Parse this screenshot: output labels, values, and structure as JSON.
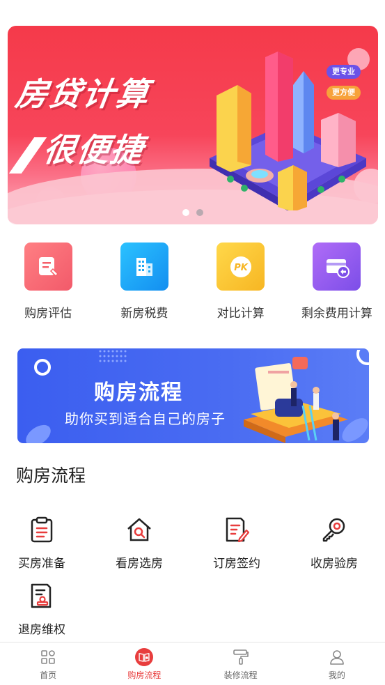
{
  "banner": {
    "title_line1": "房贷计算",
    "title_line2": "很便捷",
    "tag1": "更专业",
    "tag2": "更方便",
    "slide_count": 2,
    "active_slide": 1,
    "colors": {
      "bg": "#f53a4a",
      "tag1": "#6b52e8",
      "tag2": "#f7a23a"
    }
  },
  "tools": [
    {
      "label": "购房评估",
      "icon": "document-pen-icon",
      "color": "#f5606a"
    },
    {
      "label": "新房税费",
      "icon": "building-icon",
      "color": "#1da8f5"
    },
    {
      "label": "对比计算",
      "icon": "pk-icon",
      "color": "#f8c52e"
    },
    {
      "label": "剩余费用计算",
      "icon": "card-refund-icon",
      "color": "#9b5cf0"
    }
  ],
  "promo": {
    "title": "购房流程",
    "subtitle": "助你买到适合自己的房子"
  },
  "section": {
    "title": "购房流程"
  },
  "steps": [
    {
      "label": "买房准备",
      "icon": "clipboard-list-icon"
    },
    {
      "label": "看房选房",
      "icon": "house-search-icon"
    },
    {
      "label": "订房签约",
      "icon": "document-sign-icon"
    },
    {
      "label": "收房验房",
      "icon": "key-icon"
    },
    {
      "label": "退房维权",
      "icon": "document-stamp-icon"
    }
  ],
  "nav": [
    {
      "label": "首页",
      "icon": "grid-icon",
      "active": false
    },
    {
      "label": "购房流程",
      "icon": "book-house-icon",
      "active": true
    },
    {
      "label": "装修流程",
      "icon": "paint-roller-icon",
      "active": false
    },
    {
      "label": "我的",
      "icon": "user-icon",
      "active": false
    }
  ],
  "accent": "#e83d3d"
}
